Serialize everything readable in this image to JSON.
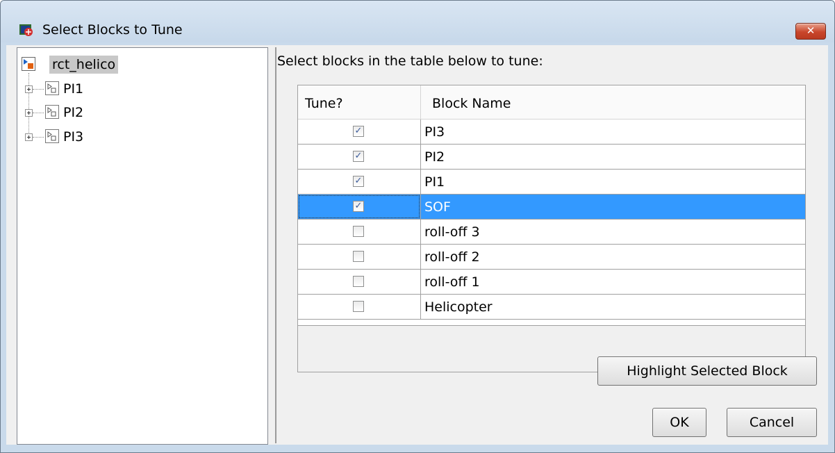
{
  "window": {
    "title": "Select Blocks to Tune",
    "close_label": "✕"
  },
  "tree": {
    "root_label": "rct_helico",
    "items": [
      {
        "label": "PI1"
      },
      {
        "label": "PI2"
      },
      {
        "label": "PI3"
      }
    ]
  },
  "instructions": "Select blocks in the table below to tune:",
  "table": {
    "columns": [
      "Tune?",
      "Block Name"
    ],
    "rows": [
      {
        "name": "PI3",
        "tune": true
      },
      {
        "name": "PI2",
        "tune": true
      },
      {
        "name": "PI1",
        "tune": true
      },
      {
        "name": "SOF",
        "tune": true,
        "selected": true
      },
      {
        "name": "roll-off 3",
        "tune": false
      },
      {
        "name": "roll-off 2",
        "tune": false
      },
      {
        "name": "roll-off 1",
        "tune": false
      },
      {
        "name": "Helicopter",
        "tune": false
      }
    ]
  },
  "buttons": {
    "highlight": "Highlight Selected Block",
    "ok": "OK",
    "cancel": "Cancel"
  },
  "colors": {
    "selection": "#3399ff",
    "titlebar": "#c9daeb",
    "close_button": "#c9462b"
  }
}
